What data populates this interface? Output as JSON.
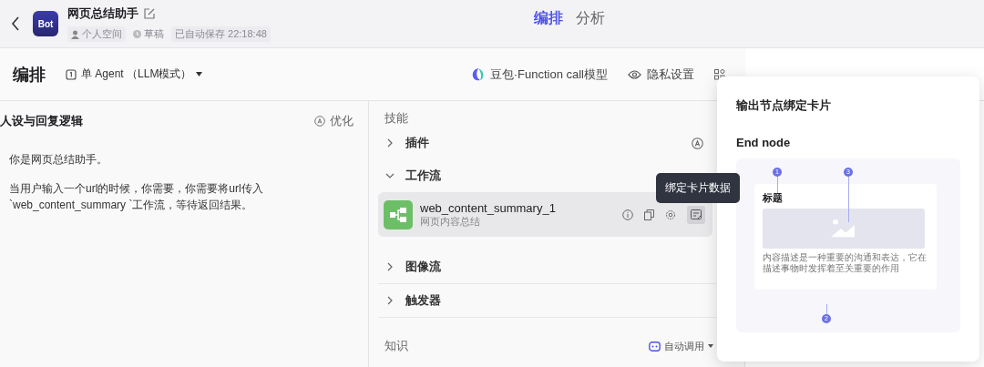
{
  "header": {
    "avatar": "Bot",
    "title": "网页总结助手",
    "meta": [
      {
        "kind": "space",
        "text": "个人空间"
      },
      {
        "kind": "status",
        "text": "草稿"
      },
      {
        "kind": "saved",
        "text": "已自动保存 22:18:48"
      }
    ]
  },
  "tabs": [
    {
      "label": "编排",
      "selected": true
    },
    {
      "label": "分析",
      "selected": false
    }
  ],
  "toolbar": {
    "title": "编排",
    "mode": "单 Agent （LLM模式）",
    "model": "豆包·Function call模型",
    "privacy": "隐私设置"
  },
  "persona": {
    "title": "人设与回复逻辑",
    "optimize": "优化",
    "paragraphs": [
      "你是网页总结助手。",
      "当用户输入一个url的时候，你需要，你需要将url传入`web_content_summary `工作流，等待返回结果。"
    ]
  },
  "skills": {
    "title": "技能",
    "sections": [
      {
        "label": "插件",
        "expanded": false,
        "auto": true
      },
      {
        "label": "工作流",
        "expanded": true,
        "auto": false,
        "items": [
          {
            "name": "web_content_summary_1",
            "description": "网页内容总结"
          }
        ]
      },
      {
        "label": "图像流",
        "expanded": false,
        "auto": false
      },
      {
        "label": "触发器",
        "expanded": false,
        "auto": false
      }
    ]
  },
  "knowledge": {
    "title": "知识",
    "mode": "自动调用"
  },
  "tooltip": "绑定卡片数据",
  "popup": {
    "title": "输出节点绑定卡片",
    "node": "End node",
    "card_title": "标题",
    "card_text": "内容描述是一种重要的沟通和表达，它在描述事物时发挥着至关重要的作用",
    "callouts": [
      "1",
      "2",
      "3"
    ]
  }
}
